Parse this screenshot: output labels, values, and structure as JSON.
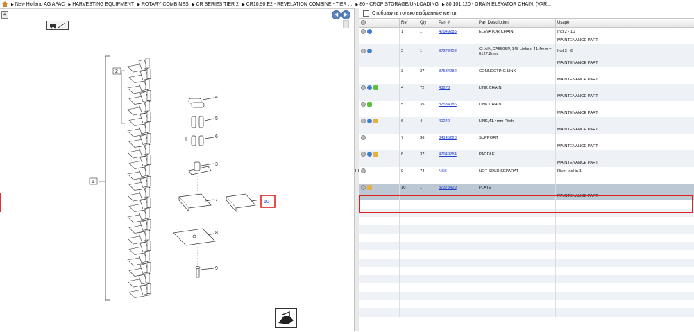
{
  "breadcrumb": [
    "New Holland AG APAC",
    "HARVESTING EQUIPMENT",
    "ROTARY COMBINES",
    "CR SERIES TIER 2",
    "CR10.90 E2 - REVELATION COMBINE - TIER ...",
    "80 - CROP STORAGE/UNLOADING",
    "80.101.120 - GRAIN ELEVATOR CHAIN; (VAR..."
  ],
  "filter": {
    "label": "Отобразить только выбранные метки",
    "checked": false
  },
  "columns": {
    "ref": "Ref",
    "qty": "Qty",
    "part": "Part #",
    "desc": "Part Description",
    "usage": "Usage"
  },
  "rows": [
    {
      "ref": "1",
      "qty": "1",
      "part": "47949285",
      "desc": "ELEVATOR CHAIN",
      "usage": "Incl 2 - 10",
      "note": "MAINTENANCE PART",
      "icons": [
        "gear",
        "blue"
      ]
    },
    {
      "ref": "2",
      "qty": "1",
      "part": "87373428",
      "desc": "CHAIN,CA550SP, 148 Links x 41.4mm = 6127.2mm",
      "usage": "Incl 3 - 6",
      "note": "MAINTENANCE PART",
      "icons": [
        "gear",
        "blue"
      ]
    },
    {
      "ref": "3",
      "qty": "37",
      "part": "87534282",
      "desc": "CONNECTING LINK",
      "usage": "",
      "note": "MAINTENANCE PART",
      "icons": []
    },
    {
      "ref": "4",
      "qty": "72",
      "part": "43278",
      "desc": "LINK CHAIN",
      "usage": "",
      "note": "MAINTENANCE PART",
      "icons": [
        "gear",
        "blue",
        "green"
      ]
    },
    {
      "ref": "5",
      "qty": "35",
      "part": "87534086",
      "desc": "LINK CHAIN",
      "usage": "",
      "note": "MAINTENANCE PART",
      "icons": [
        "gear",
        "green"
      ]
    },
    {
      "ref": "6",
      "qty": "4",
      "part": "40242",
      "desc": "LINK,41.4mm Pitch",
      "usage": "",
      "note": "MAINTENANCE PART",
      "icons": [
        "gear",
        "blue",
        "box"
      ]
    },
    {
      "ref": "7",
      "qty": "36",
      "part": "84145228",
      "desc": "SUPPORT",
      "usage": "",
      "note": "MAINTENANCE PART",
      "icons": [
        "gear"
      ]
    },
    {
      "ref": "8",
      "qty": "37",
      "part": "47949284",
      "desc": "PADDLE",
      "usage": "",
      "note": "MAINTENANCE PART",
      "icons": [
        "gear",
        "blue",
        "box"
      ]
    },
    {
      "ref": "9",
      "qty": "74",
      "part": "NSS",
      "desc": "NOT SOLD SEPARAT",
      "usage": "Rivet Incl in 1",
      "note": "",
      "icons": [
        "gear"
      ]
    },
    {
      "ref": "10",
      "qty": "1",
      "part": "87373429",
      "desc": "PLATE",
      "usage": "",
      "note": "MAINTENANCE PART",
      "icons": [
        "gear",
        "box"
      ]
    }
  ],
  "selected_ref": "10",
  "diagram": {
    "callouts": [
      "1",
      "2",
      "3",
      "4",
      "5",
      "6",
      "7",
      "8",
      "9",
      "10"
    ],
    "highlighted": "10"
  }
}
